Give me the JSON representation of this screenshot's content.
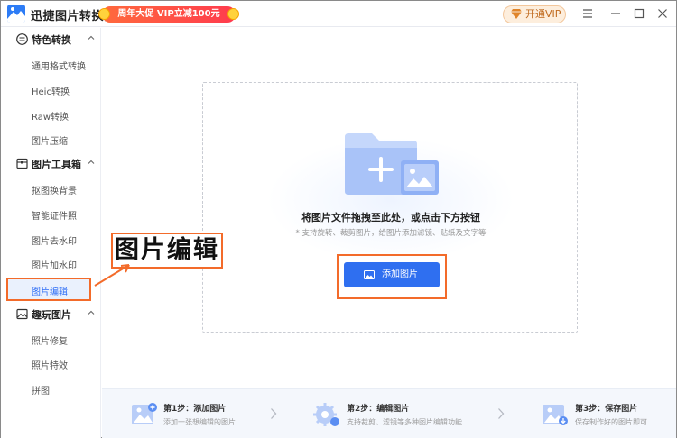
{
  "app": {
    "title": "迅捷图片转换器"
  },
  "promo": {
    "text": "周年大促 VIP立减100元"
  },
  "header": {
    "vip_label": "开通VIP"
  },
  "sidebar": {
    "groups": [
      {
        "label": "特色转换",
        "items": [
          "通用格式转换",
          "Heic转换",
          "Raw转换",
          "图片压缩"
        ]
      },
      {
        "label": "图片工具箱",
        "items": [
          "抠图换背景",
          "智能证件照",
          "图片去水印",
          "图片加水印",
          "图片编辑"
        ]
      },
      {
        "label": "趣玩图片",
        "items": [
          "照片修复",
          "照片特效",
          "拼图"
        ]
      }
    ],
    "selected_item": "图片编辑"
  },
  "dropzone": {
    "title": "将图片文件拖拽至此处，或点击下方按钮",
    "subtitle": "* 支持旋转、裁剪图片，给图片添加滤镜、贴纸及文字等",
    "button_label": "添加图片"
  },
  "annotation": {
    "text": "图片编辑"
  },
  "steps": [
    {
      "title": "第1步：添加图片",
      "desc": "添加一张想编辑的图片"
    },
    {
      "title": "第2步：编辑图片",
      "desc": "支持裁剪、滤镜等多种图片编辑功能"
    },
    {
      "title": "第3步：保存图片",
      "desc": "保存制作好的图片即可"
    }
  ],
  "colors": {
    "accent": "#2f6ff0",
    "highlight_border": "#f36b2a",
    "promo": "#ff4d3d"
  }
}
